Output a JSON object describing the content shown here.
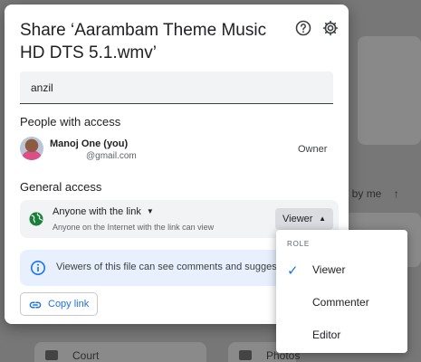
{
  "background": {
    "shared_by_label": "ed by me",
    "sort_arrow": "↑",
    "folders": [
      "Court",
      "Photos"
    ]
  },
  "dialog": {
    "title": "Share ‘Aarambam Theme Music HD DTS 5.1.wmv’",
    "help_icon": "help-circle-icon",
    "settings_icon": "gear-icon",
    "add_people_value": "anzil",
    "people_section_title": "People with access",
    "people": [
      {
        "name": "Manoj One (you)",
        "email": "@gmail.com",
        "role": "Owner"
      }
    ],
    "general_section_title": "General access",
    "general_access": {
      "icon": "globe-icon",
      "setting": "Anyone with the link",
      "description": "Anyone on the Internet with the link can view",
      "role": "Viewer"
    },
    "info_banner": "Viewers of this file can see comments and suggestions",
    "copy_link_label": "Copy link",
    "colors": {
      "accent": "#1a73e8",
      "banner": "#e8f0fe",
      "globe": "#188038"
    }
  },
  "role_menu": {
    "header": "ROLE",
    "items": [
      {
        "label": "Viewer",
        "checked": true
      },
      {
        "label": "Commenter",
        "checked": false
      },
      {
        "label": "Editor",
        "checked": false
      }
    ]
  }
}
